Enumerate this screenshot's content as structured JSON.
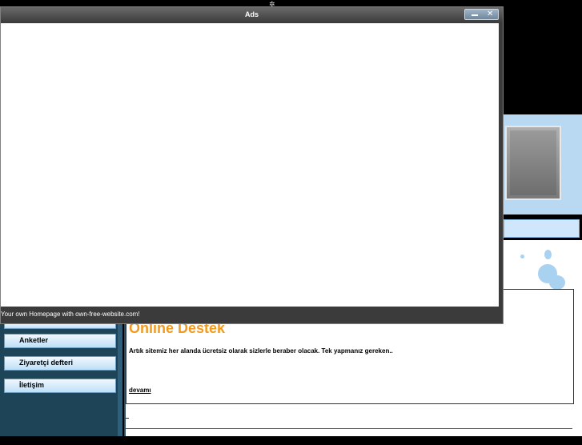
{
  "window": {
    "title": "Ads",
    "footer": "Your own Homepage with own-free-website.com!",
    "close_glyph": "✕",
    "top_glyph": "✲"
  },
  "sidebar": {
    "items": [
      {
        "label": "Anketler"
      },
      {
        "label": "Ziyaretçi defteri"
      },
      {
        "label": "İletişim"
      }
    ]
  },
  "content": {
    "title": "Online Destek",
    "text": "Artık sitemiz her alanda ücretsiz olarak sizlerle beraber olacak. Tek yapmanız gereken..",
    "link": "devamı"
  },
  "colors": {
    "title_accent": "#f39a1d",
    "sidebar_bg": "#1e4458",
    "splat": "#a9d2f0"
  }
}
